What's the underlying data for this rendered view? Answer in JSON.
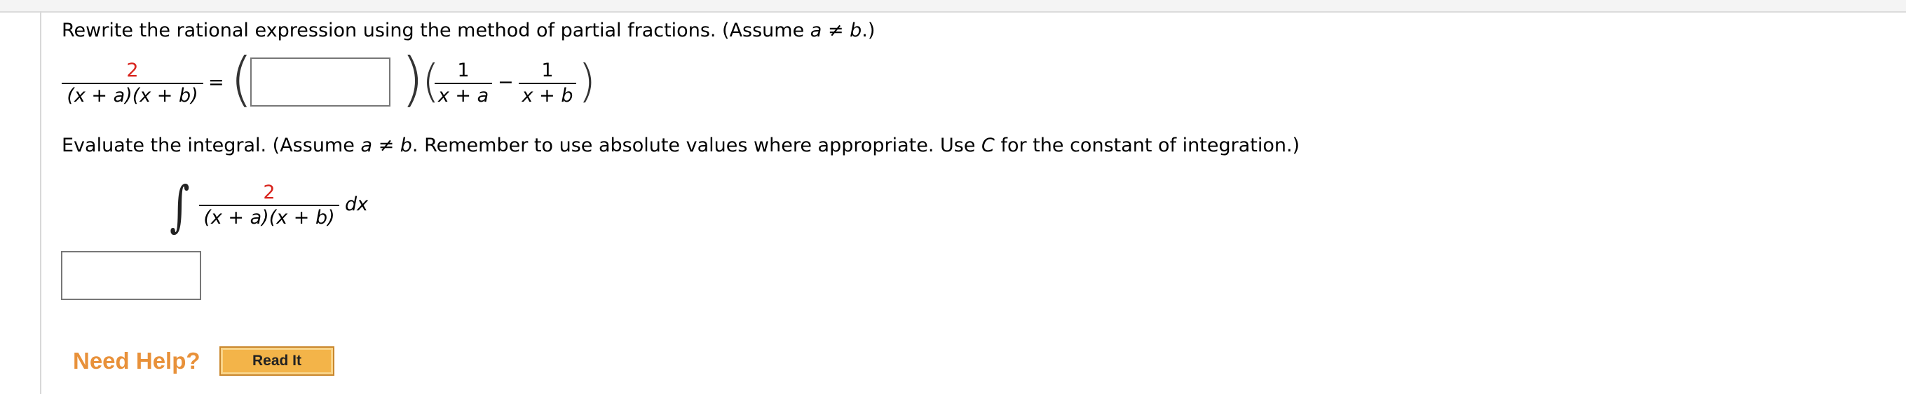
{
  "question1": {
    "prompt_text": "Rewrite the rational expression using the method of partial fractions. (Assume ",
    "prompt_cond": "a ≠ b",
    "prompt_tail": ".)",
    "lhs_numerator": "2",
    "lhs_denominator": "(x + a)(x + b)",
    "equals": "=",
    "frac1_numerator": "1",
    "frac1_denominator": "x + a",
    "minus": "−",
    "frac2_numerator": "1",
    "frac2_denominator": "x + b",
    "answer_value": ""
  },
  "question2": {
    "prompt_text": "Evaluate the integral. (Assume ",
    "prompt_cond": "a ≠ b",
    "prompt_mid": ". Remember to use absolute values where appropriate. Use ",
    "prompt_c": "C",
    "prompt_tail": " for the constant of integration.)",
    "integral_symbol": "∫",
    "numerator": "2",
    "denominator": "(x + a)(x + b)",
    "differential": "dx",
    "answer_value": ""
  },
  "help": {
    "label": "Need Help?",
    "read_it_label": "Read It"
  },
  "colors": {
    "given_value": "#d8231c",
    "need_help": "#e8913a",
    "read_it_bg": "#f3b449"
  }
}
